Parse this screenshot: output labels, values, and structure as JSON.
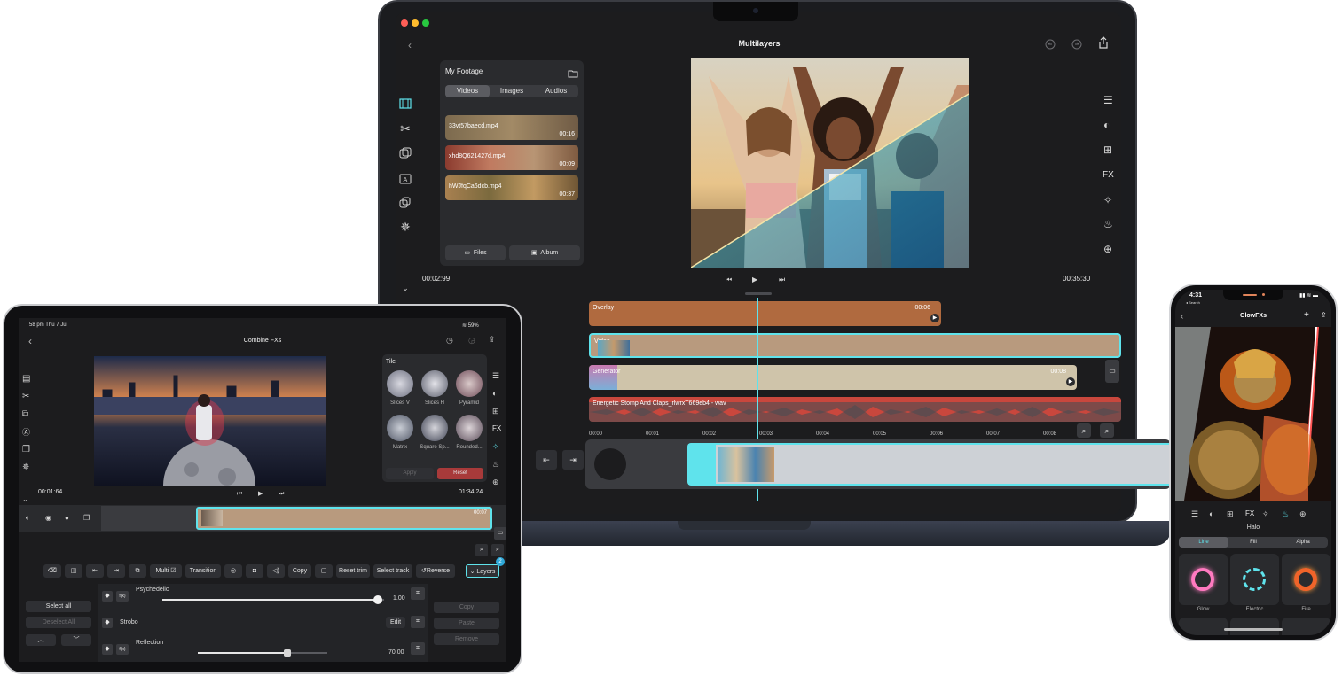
{
  "mac": {
    "title": "Multilayers",
    "footage": {
      "header": "My Footage",
      "tabs": [
        "Videos",
        "Images",
        "Audios"
      ],
      "clips": [
        {
          "name": "33vt57baecd.mp4",
          "duration": "00:16"
        },
        {
          "name": "xhd8Q621427d.mp4",
          "duration": "00:09"
        },
        {
          "name": "hWJfqCa6dcb.mp4",
          "duration": "00:37"
        }
      ],
      "files_label": "Files",
      "album_label": "Album"
    },
    "current_time": "00:02:99",
    "total_time": "00:35:30",
    "right_fx_label": "FX",
    "timeline": {
      "tracks": [
        {
          "label": "Overlay",
          "duration": "00:06"
        },
        {
          "label": "Video",
          "duration": ""
        },
        {
          "label": "Generator",
          "duration": "00:08"
        },
        {
          "label": "Energetic Stomp And Claps_rlwrxT669eb4 - wav",
          "duration": ""
        }
      ],
      "ruler": [
        "00:00",
        "00:01",
        "00:02",
        "00:03",
        "00:04",
        "00:05",
        "00:06",
        "00:07",
        "00:08"
      ]
    },
    "colors": {
      "overlay": "#b06a3f",
      "video": "#b89a7e",
      "generator": "#cfc4aa",
      "audio": "#c9473d",
      "accent": "#5fe3ec"
    }
  },
  "ipad": {
    "status_time": "58 pm  Thu 7 Jul",
    "status_battery": "59%",
    "title": "Combine FXs",
    "current_time": "00:01:64",
    "total_time": "01:34:24",
    "tile_panel": {
      "header": "Tile",
      "items": [
        "Slices V",
        "Slices H",
        "Pyramid",
        "Matrix",
        "Square Sp...",
        "Rounded..."
      ],
      "apply": "Apply",
      "reset": "Reset"
    },
    "fx_label": "FX",
    "track_duration": "00:07",
    "toolbar": [
      "Multi",
      "Transition",
      "Copy",
      "Reset trim",
      "Select track",
      "Reverse",
      "Layers"
    ],
    "layers_badge": "2",
    "left": {
      "select_all": "Select all",
      "deselect_all": "Deselect All"
    },
    "right": {
      "copy": "Copy",
      "paste": "Paste",
      "remove": "Remove"
    },
    "effects": [
      {
        "name": "Psychedelic",
        "value": "1.00",
        "level": 0.97
      },
      {
        "name": "Strobo",
        "edit": "Edit"
      },
      {
        "name": "Reflection",
        "value": "70.00",
        "level": 0.7
      }
    ],
    "fx_badge": "f(x)"
  },
  "iphone": {
    "time": "4:31",
    "back_label": "◂ Search",
    "title": "GlowFXs",
    "toolbar_fx": "FX",
    "section": "Halo",
    "tabs": [
      "Line",
      "Fill",
      "Alpha"
    ],
    "effects": [
      "Glow",
      "Electric",
      "Fire"
    ]
  }
}
